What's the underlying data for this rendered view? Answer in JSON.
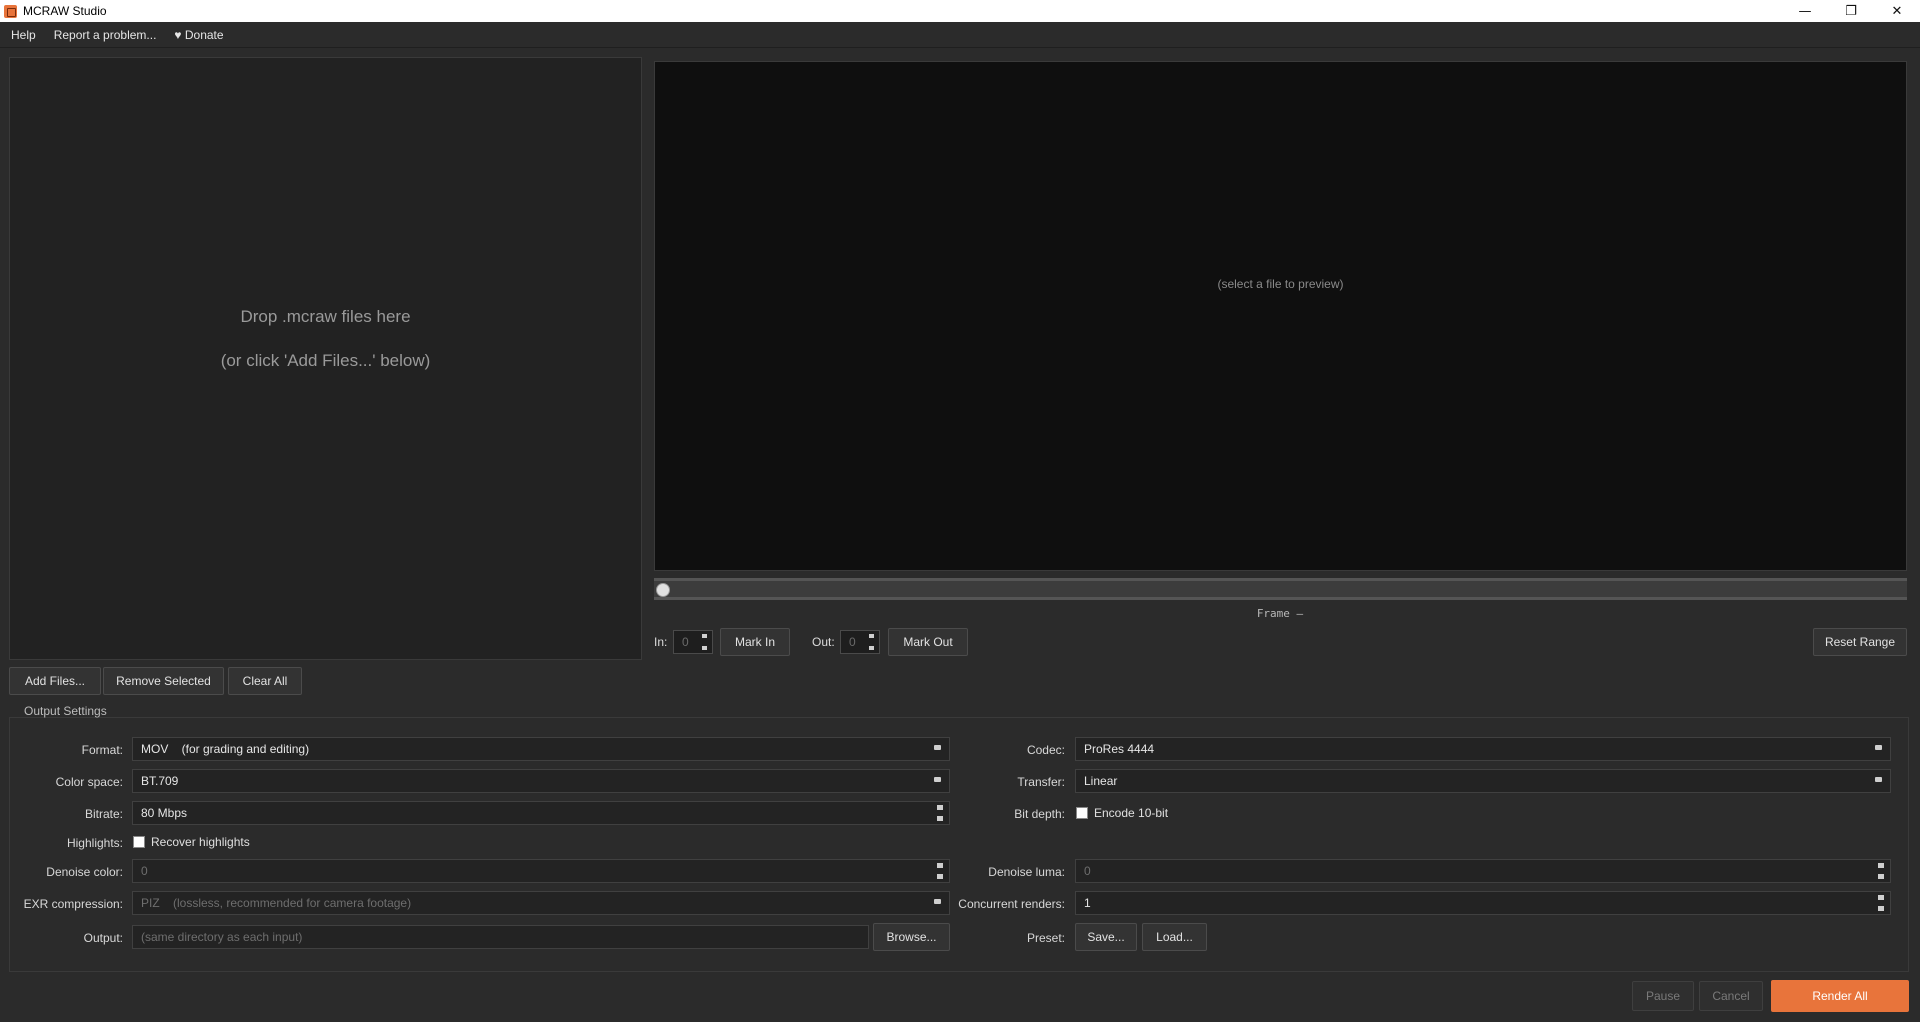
{
  "window": {
    "title": "MCRAW Studio",
    "controls": {
      "minimize": "—",
      "restore": "❐",
      "close": "✕"
    }
  },
  "menu": {
    "items": [
      "Help",
      "Report a problem...",
      "♥ Donate"
    ]
  },
  "dropzone": {
    "line1": "Drop .mcraw files here",
    "line2": "(or click 'Add Files...' below)"
  },
  "file_buttons": {
    "add": "Add Files...",
    "remove": "Remove Selected",
    "clear": "Clear All"
  },
  "preview": {
    "placeholder": "(select a file to preview)",
    "frame_label": "Frame —",
    "slider_value": 0
  },
  "range": {
    "in_label": "In:",
    "in_value": "0",
    "mark_in": "Mark In",
    "out_label": "Out:",
    "out_value": "0",
    "mark_out": "Mark Out",
    "reset": "Reset Range"
  },
  "output_settings": {
    "title": "Output Settings",
    "format": {
      "label": "Format:",
      "value": "MOV    (for grading and editing)"
    },
    "color_space": {
      "label": "Color space:",
      "value": "BT.709"
    },
    "bitrate": {
      "label": "Bitrate:",
      "value": "80 Mbps"
    },
    "highlights": {
      "label": "Highlights:",
      "check_label": "Recover highlights",
      "checked": false
    },
    "denoise_color": {
      "label": "Denoise color:",
      "value": "0"
    },
    "exr_compression": {
      "label": "EXR compression:",
      "value": "PIZ    (lossless, recommended for camera footage)"
    },
    "output": {
      "label": "Output:",
      "placeholder": "(same directory as each input)",
      "browse": "Browse..."
    },
    "codec": {
      "label": "Codec:",
      "value": "ProRes 4444"
    },
    "transfer": {
      "label": "Transfer:",
      "value": "Linear"
    },
    "bit_depth": {
      "label": "Bit depth:",
      "check_label": "Encode 10-bit",
      "checked": false
    },
    "denoise_luma": {
      "label": "Denoise luma:",
      "value": "0"
    },
    "concurrent": {
      "label": "Concurrent renders:",
      "value": "1"
    },
    "preset": {
      "label": "Preset:",
      "save": "Save...",
      "load": "Load..."
    }
  },
  "actions": {
    "pause": "Pause",
    "cancel": "Cancel",
    "render": "Render All"
  },
  "colors": {
    "accent": "#e8743b",
    "background": "#2b2b2b",
    "preview_bg": "#0f0f0f"
  }
}
